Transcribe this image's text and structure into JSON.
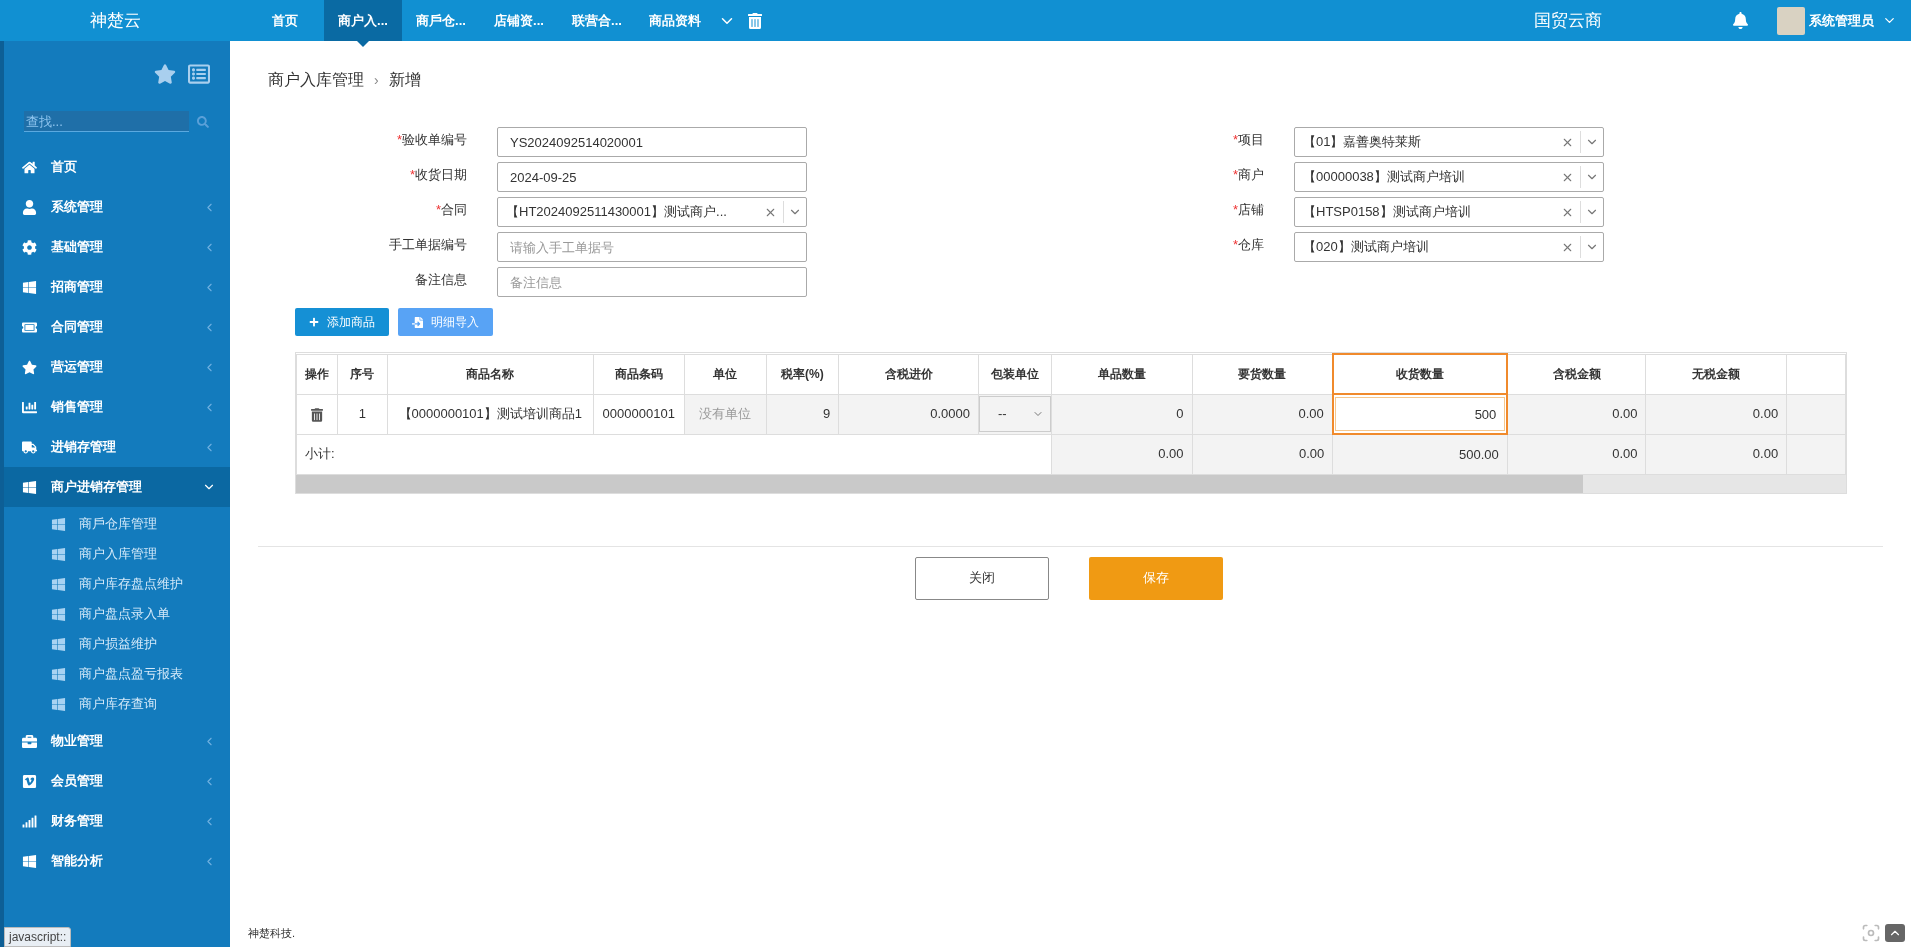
{
  "app": {
    "logo": "神楚云",
    "brand": "国贸云商",
    "user": "系统管理员",
    "status_text": "javascript::",
    "footer": "神楚科技."
  },
  "tabs": [
    {
      "label": "首页",
      "selected": false
    },
    {
      "label": "商户入...",
      "selected": true
    },
    {
      "label": "商戶仓...",
      "selected": false
    },
    {
      "label": "店铺资...",
      "selected": false
    },
    {
      "label": "联营合...",
      "selected": false
    },
    {
      "label": "商品资料",
      "selected": false
    }
  ],
  "sidebar": {
    "search": {
      "placeholder": "查找..."
    },
    "items": [
      {
        "label": "首页",
        "expanded": false
      },
      {
        "label": "系统管理",
        "expanded": false
      },
      {
        "label": "基础管理",
        "expanded": false
      },
      {
        "label": "招商管理",
        "expanded": false
      },
      {
        "label": "合同管理",
        "expanded": false
      },
      {
        "label": "营运管理",
        "expanded": false
      },
      {
        "label": "销售管理",
        "expanded": false
      },
      {
        "label": "进销存管理",
        "expanded": false
      },
      {
        "label": "商户进销存管理",
        "expanded": true,
        "children": [
          {
            "label": "商戶仓库管理"
          },
          {
            "label": "商户入库管理"
          },
          {
            "label": "商户库存盘点维护"
          },
          {
            "label": "商户盘点录入单"
          },
          {
            "label": "商户损益维护"
          },
          {
            "label": "商户盘点盈亏报表"
          },
          {
            "label": "商户库存查询"
          }
        ]
      },
      {
        "label": "物业管理",
        "expanded": false
      },
      {
        "label": "会员管理",
        "expanded": false
      },
      {
        "label": "财务管理",
        "expanded": false
      },
      {
        "label": "智能分析",
        "expanded": false
      }
    ]
  },
  "breadcrumb": {
    "separator": "›",
    "items": [
      "商户入库管理",
      "新增"
    ]
  },
  "form": {
    "left": [
      {
        "required_mark": "*",
        "label": "验收单编号",
        "kind": "text",
        "value": "YS2024092514020001"
      },
      {
        "required_mark": "*",
        "label": "收货日期",
        "kind": "text",
        "value": "2024-09-25"
      },
      {
        "required_mark": "*",
        "label": "合同",
        "kind": "select",
        "value": "【HT2024092511430001】测试商户..."
      },
      {
        "label": "手工单据编号",
        "kind": "text",
        "placeholder": "请输入手工单据号"
      },
      {
        "label": "备注信息",
        "kind": "text",
        "placeholder": "备注信息"
      }
    ],
    "right": [
      {
        "required_mark": "*",
        "label": "项目",
        "kind": "select",
        "value": "【01】嘉善奥特莱斯"
      },
      {
        "required_mark": "*",
        "label": "商户",
        "kind": "select",
        "value": "【00000038】测试商户培训"
      },
      {
        "required_mark": "*",
        "label": "店铺",
        "kind": "select",
        "value": "【HTSP0158】测试商户培训"
      },
      {
        "required_mark": "*",
        "label": "仓库",
        "kind": "select",
        "value": "【020】测试商户培训"
      }
    ]
  },
  "toolbar": [
    {
      "label": "添加商品",
      "kind": "add"
    },
    {
      "label": "明细导入",
      "kind": "import"
    }
  ],
  "table": {
    "columns": [
      {
        "label": "操作",
        "highlighted": false
      },
      {
        "label": "序号",
        "highlighted": false
      },
      {
        "label": "商品名称",
        "highlighted": false
      },
      {
        "label": "商品条码",
        "highlighted": false
      },
      {
        "label": "单位",
        "highlighted": false
      },
      {
        "label": "税率(%)",
        "highlighted": false
      },
      {
        "label": "含税进价",
        "highlighted": false
      },
      {
        "label": "包装单位",
        "highlighted": false
      },
      {
        "label": "单品数量",
        "highlighted": false
      },
      {
        "label": "要货数量",
        "highlighted": false
      },
      {
        "label": "收货数量",
        "highlighted": true
      },
      {
        "label": "含税金额",
        "highlighted": false
      },
      {
        "label": "无税金额",
        "highlighted": false
      }
    ],
    "rows": [
      {
        "cells": [
          {
            "kind": "delete",
            "readonly": false
          },
          {
            "kind": "text",
            "text": "1",
            "readonly": false
          },
          {
            "kind": "text",
            "text": "【0000000101】测试培训商品1",
            "readonly": false
          },
          {
            "kind": "text",
            "text": "0000000101",
            "readonly": false
          },
          {
            "kind": "muted",
            "text": "没有单位",
            "readonly": true
          },
          {
            "kind": "number",
            "text": "9",
            "readonly": true
          },
          {
            "kind": "number",
            "text": "0.0000",
            "readonly": true
          },
          {
            "kind": "select",
            "text": "--",
            "readonly": true
          },
          {
            "kind": "number",
            "text": "0",
            "readonly": true
          },
          {
            "kind": "number",
            "text": "0.00",
            "readonly": true
          },
          {
            "kind": "input",
            "text": "500",
            "readonly": false
          },
          {
            "kind": "number",
            "text": "0.00",
            "readonly": true
          },
          {
            "kind": "number",
            "text": "0.00",
            "readonly": true
          }
        ]
      }
    ],
    "subtotal": {
      "label": "小计:",
      "values": [
        "0.00",
        "0.00",
        "500.00",
        "0.00",
        "0.00"
      ]
    }
  },
  "actions": [
    {
      "label": "关闭",
      "kind": "secondary"
    },
    {
      "label": "保存",
      "kind": "primary"
    }
  ]
}
